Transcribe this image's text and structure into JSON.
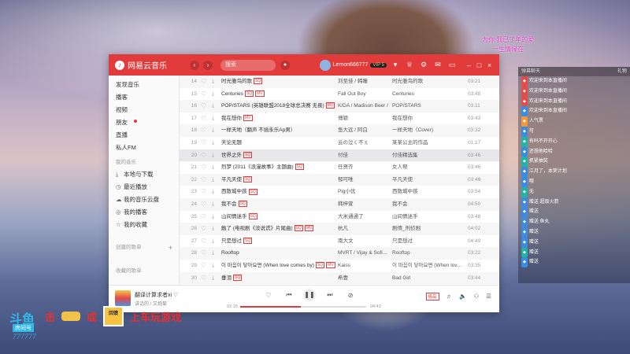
{
  "app": {
    "name": "网易云音乐",
    "search_placeholder": "搜索",
    "username": "Lemon666777",
    "vip_label": "VIP 5"
  },
  "sidebar": {
    "items": [
      {
        "label": "发现音乐",
        "active": false
      },
      {
        "label": "播客",
        "active": false
      },
      {
        "label": "视频",
        "active": false
      },
      {
        "label": "朋友",
        "active": false,
        "dot": true
      },
      {
        "label": "直播",
        "active": false
      },
      {
        "label": "私人FM",
        "active": false
      }
    ],
    "section_my": "我的音乐",
    "my_items": [
      {
        "label": "本地与下载",
        "icon": "download-icon"
      },
      {
        "label": "最近播放",
        "icon": "clock-icon"
      },
      {
        "label": "我的音乐云盘",
        "icon": "cloud-icon"
      },
      {
        "label": "我的播客",
        "icon": "podcast-icon"
      },
      {
        "label": "我的收藏",
        "icon": "star-icon"
      }
    ],
    "section_created": "创建的歌单",
    "section_collected": "收藏的歌单"
  },
  "songs": [
    {
      "num": "14",
      "title": "时光雏鸟的歌",
      "tags": [
        "SQ"
      ],
      "artist": "刘至佳 / 韩瞳",
      "album": "时光雏鸟的歌",
      "duration": "03:21"
    },
    {
      "num": "15",
      "title": "Centuries",
      "tags": [
        "SQ",
        "MV"
      ],
      "artist": "Fall Out Boy",
      "album": "Centuries",
      "duration": "03:48"
    },
    {
      "num": "16",
      "title": "POP/STARS (英雄联盟2018全球总决赛 无畏)",
      "tags": [
        "MV"
      ],
      "artist": "K/DA / Madison Beer /",
      "album": "POP/STARS",
      "duration": "03:11"
    },
    {
      "num": "17",
      "title": "我在想你",
      "tags": [
        "MV"
      ],
      "artist": "傅颖",
      "album": "我在想你",
      "duration": "03:43"
    },
    {
      "num": "18",
      "title": "一样天地（翻声 不插永乐Ap男）",
      "tags": [],
      "artist": "鱼大远 / 阿白",
      "album": "一样天地（Cover)",
      "duration": "03:32"
    },
    {
      "num": "19",
      "title": "天论无题",
      "tags": [],
      "artist": "云の泣く不ぇ",
      "album": "某某公主的作品",
      "duration": "01:17"
    },
    {
      "num": "20",
      "title": "世界之外",
      "tags": [
        "SQ"
      ],
      "artist": "付佳",
      "album": "付佳精选集",
      "duration": "03:46"
    },
    {
      "num": "21",
      "title": "烈梦 (2011《浪漫故事》主题曲)",
      "tags": [
        "SQ"
      ],
      "artist": "任贤齐",
      "album": "女人帮",
      "duration": "03:46"
    },
    {
      "num": "22",
      "title": "平凡天使",
      "tags": [
        "SQ"
      ],
      "artist": "郁可唯",
      "album": "平凡天使",
      "duration": "03:46"
    },
    {
      "num": "23",
      "title": "西散城中孩",
      "tags": [
        "SQ"
      ],
      "artist": "Pig小优",
      "album": "西散城中孩",
      "duration": "03:54"
    },
    {
      "num": "24",
      "title": "我不会",
      "tags": [
        "SQ"
      ],
      "artist": "韩梓萱",
      "album": "我不会",
      "duration": "04:50"
    },
    {
      "num": "25",
      "title": "山间情迷手",
      "tags": [
        "SQ"
      ],
      "artist": "大米通通了",
      "album": "山间情迷手",
      "duration": "03:48"
    },
    {
      "num": "26",
      "title": "触了 (电视剧《没说谎》片尾曲)",
      "tags": [
        "SQ",
        "MV"
      ],
      "artist": "杭凡",
      "album": "剧情_刑侦剧",
      "duration": "04:02"
    },
    {
      "num": "27",
      "title": "只是想过",
      "tags": [
        "SQ"
      ],
      "artist": "南大文",
      "album": "只是想过",
      "duration": "04:49"
    },
    {
      "num": "28",
      "title": "Rooftop",
      "tags": [],
      "artist": "MVRT / Vijay & Sofia Z",
      "album": "Rooftop",
      "duration": "03:22"
    },
    {
      "num": "29",
      "title": "이 마음이 닿아요면 (When love comes by)",
      "tags": [
        "SQ",
        "MV"
      ],
      "artist": "Kaiss",
      "album": "이 마음이 닿아요면 (When love comes by)",
      "duration": "03:35"
    },
    {
      "num": "30",
      "title": "垂泪",
      "tags": [
        "SQ"
      ],
      "artist": "希壹",
      "album": "Bad Girl",
      "duration": "03:44"
    }
  ],
  "player": {
    "title": "翻译计算求者xi",
    "artist": "讲话的 / 又炮菊",
    "elapsed": "02:15",
    "total": "04:43",
    "progress": 0.48,
    "quality_label": "极高"
  },
  "chat": {
    "title": "弹幕聊天",
    "gift_label": "礼物",
    "messages": [
      {
        "badge": "red",
        "text": "欢迎来到本直播间"
      },
      {
        "badge": "red",
        "text": "欢迎来到本直播间"
      },
      {
        "badge": "red",
        "text": "欢迎来到本直播间"
      },
      {
        "badge": "blue",
        "text": "欢迎来到本直播间"
      },
      {
        "badge": "orange",
        "text": "人气票"
      },
      {
        "badge": "blue",
        "text": "可"
      },
      {
        "badge": "teal",
        "text": "有吗不开开心"
      },
      {
        "badge": "blue",
        "text": "还想他哈哈"
      },
      {
        "badge": "teal",
        "text": "抓紧抽奖"
      },
      {
        "badge": "blue",
        "text": "江月了，本荣计划"
      },
      {
        "badge": "blue",
        "text": "哦"
      },
      {
        "badge": "teal",
        "text": "无"
      },
      {
        "badge": "blue",
        "text": "赠送 超级火箭"
      },
      {
        "badge": "blue",
        "text": "赠送"
      },
      {
        "badge": "blue",
        "text": "赠送 鱼丸"
      },
      {
        "badge": "blue",
        "text": "赠送"
      },
      {
        "badge": "blue",
        "text": "赠送"
      },
      {
        "badge": "teal",
        "text": "赠送"
      },
      {
        "badge": "blue",
        "text": "赠送"
      }
    ]
  },
  "overlay": {
    "banner_line1": "为你 我已了年的爱",
    "banner_line2": "一生情缘在",
    "promo_left": "击",
    "promo_or": "或",
    "promo_box": "回馈",
    "promo_right": "上车玩游戏",
    "douyu": "斗鱼",
    "room_label": "房间号",
    "room_id": "777777"
  }
}
